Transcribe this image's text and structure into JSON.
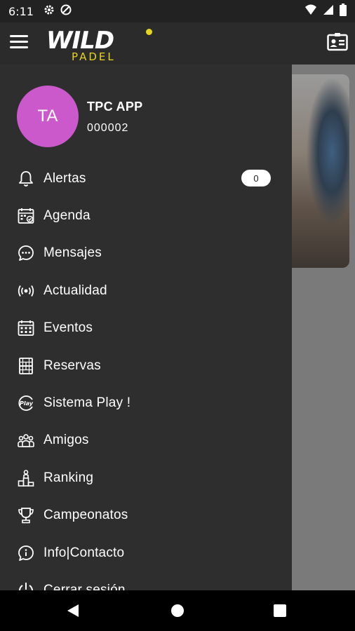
{
  "status_bar": {
    "time": "6:11",
    "left_icons": [
      "gear-icon",
      "do-not-disturb-icon"
    ],
    "right_icons": [
      "wifi-icon",
      "signal-icon",
      "battery-icon"
    ]
  },
  "app_bar": {
    "logo_top": "WILD",
    "logo_bottom": "PADEL",
    "brand_color": "#e6d51f",
    "right_icon": "id-card-icon"
  },
  "profile": {
    "initials": "TA",
    "name": "TPC APP",
    "code": "000002",
    "avatar_color": "#cc59cc"
  },
  "menu": {
    "items": [
      {
        "label": "Alertas",
        "icon": "bell-icon",
        "badge": "0"
      },
      {
        "label": "Agenda",
        "icon": "calendar-check-icon"
      },
      {
        "label": "Mensajes",
        "icon": "chat-icon"
      },
      {
        "label": "Actualidad",
        "icon": "broadcast-icon"
      },
      {
        "label": "Eventos",
        "icon": "calendar-grid-icon"
      },
      {
        "label": "Reservas",
        "icon": "court-icon"
      },
      {
        "label": "Sistema Play !",
        "icon": "play-badge-icon"
      },
      {
        "label": "Amigos",
        "icon": "friends-icon"
      },
      {
        "label": "Ranking",
        "icon": "podium-icon"
      },
      {
        "label": "Campeonatos",
        "icon": "trophy-icon"
      },
      {
        "label": "Info|Contacto",
        "icon": "info-icon"
      },
      {
        "label": "Cerrar sesión",
        "icon": "power-icon"
      }
    ]
  },
  "nav_bar": {
    "buttons": [
      "back-icon",
      "home-icon",
      "recent-apps-icon"
    ]
  }
}
